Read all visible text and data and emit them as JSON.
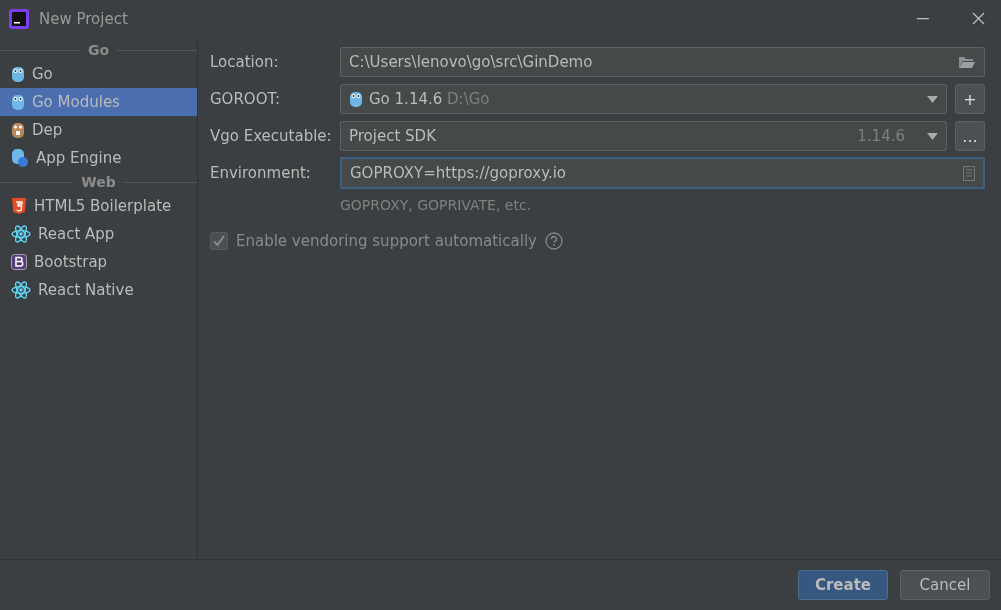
{
  "window": {
    "title": "New Project"
  },
  "sidebar": {
    "items": [
      {
        "kind": "header",
        "label": "Go"
      },
      {
        "kind": "item",
        "label": "Go",
        "selected": false
      },
      {
        "kind": "item",
        "label": "Go Modules",
        "selected": true
      },
      {
        "kind": "item",
        "label": "Dep",
        "selected": false
      },
      {
        "kind": "item",
        "label": "App Engine",
        "selected": false
      },
      {
        "kind": "header",
        "label": "Web"
      },
      {
        "kind": "item",
        "label": "HTML5 Boilerplate",
        "selected": false
      },
      {
        "kind": "item",
        "label": "React App",
        "selected": false
      },
      {
        "kind": "item",
        "label": "Bootstrap",
        "selected": false
      },
      {
        "kind": "item",
        "label": "React Native",
        "selected": false
      }
    ]
  },
  "form": {
    "location": {
      "label": "Location:",
      "value": "C:\\Users\\lenovo\\go\\src\\GinDemo"
    },
    "goroot": {
      "label": "GOROOT:",
      "value": "Go 1.14.6",
      "detail": "D:\\Go",
      "button": "+"
    },
    "vgo": {
      "label": "Vgo Executable:",
      "value": "Project SDK",
      "detail": "1.14.6",
      "button": "..."
    },
    "environment": {
      "label": "Environment:",
      "value": "GOPROXY=https://goproxy.io",
      "focused": true,
      "hint": "GOPROXY, GOPRIVATE, etc."
    },
    "vendoring": {
      "label": "Enable vendoring support automatically",
      "checked": true,
      "disabled": true
    }
  },
  "buttons": [
    {
      "label": "Create",
      "primary": true
    },
    {
      "label": "Cancel",
      "primary": false
    }
  ]
}
